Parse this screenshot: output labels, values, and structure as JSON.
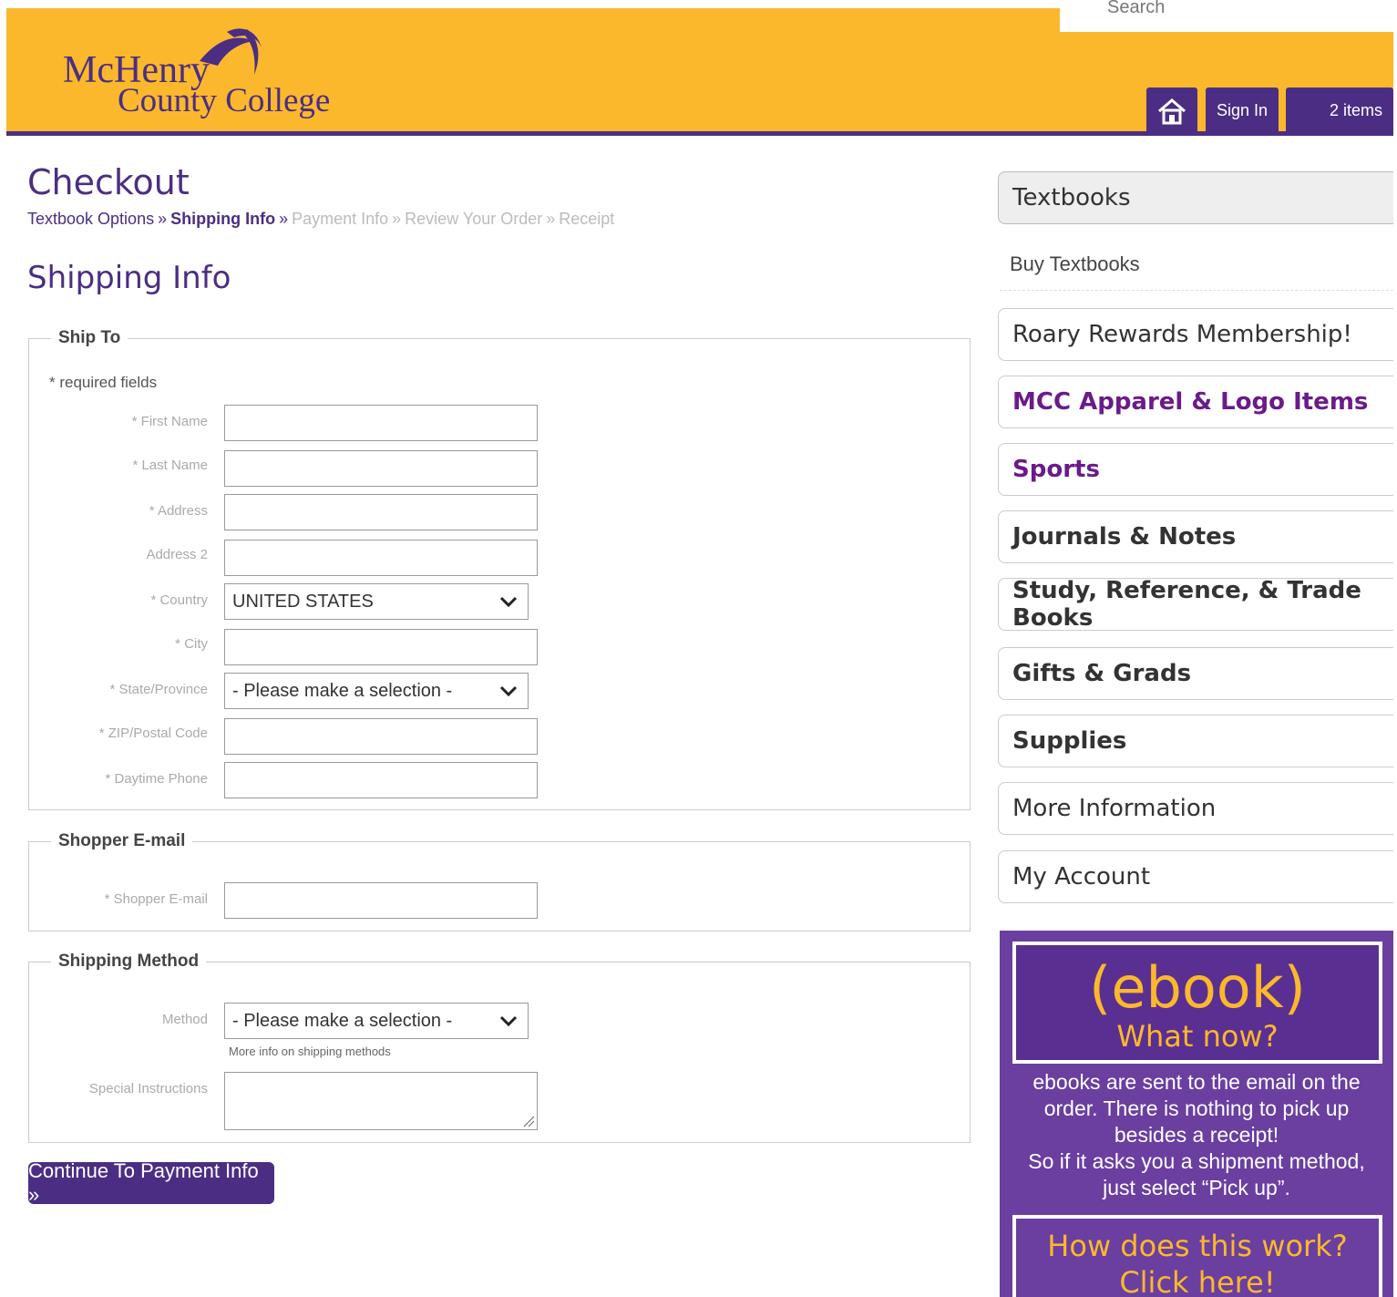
{
  "header": {
    "logo_line1": "McHenry",
    "logo_line2": "County College",
    "search_label": "Search",
    "sign_in": "Sign In",
    "cart": "2 items"
  },
  "page": {
    "title": "Checkout",
    "breadcrumbs": [
      "Textbook Options",
      "Shipping Info",
      "Payment Info",
      "Review Your Order",
      "Receipt"
    ],
    "subtitle": "Shipping Info"
  },
  "ship_to": {
    "legend": "Ship To",
    "required_note": "* required fields",
    "fields": {
      "first_name": "* First Name",
      "last_name": "* Last Name",
      "address": "* Address",
      "address2": "Address 2",
      "country": "* Country",
      "city": "* City",
      "state": "* State/Province",
      "zip": "* ZIP/Postal Code",
      "phone": "* Daytime Phone"
    },
    "country_value": "UNITED STATES",
    "state_value": "- Please make a selection -"
  },
  "email": {
    "legend": "Shopper E-mail",
    "label": "* Shopper E-mail"
  },
  "shipping_method": {
    "legend": "Shipping Method",
    "method_label": "Method",
    "method_value": "- Please make a selection -",
    "info_link": "More info on shipping methods",
    "instructions_label": "Special Instructions"
  },
  "continue_button": "Continue To Payment Info »",
  "sidebar": {
    "textbooks": "Textbooks",
    "buy_textbooks": "Buy Textbooks",
    "items": [
      "Roary Rewards Membership!",
      "MCC Apparel & Logo Items",
      "Sports",
      "Journals & Notes",
      "Study, Reference, & Trade Books",
      "Gifts & Grads",
      "Supplies",
      "More Information",
      "My Account"
    ]
  },
  "promo": {
    "ebook": "(ebook)",
    "what_now": "What now?",
    "line1": "ebooks are sent to the email on the",
    "line2": "order. There is nothing to pick up",
    "line3": "besides a receipt!",
    "line4": "So if it asks you a shipment method,",
    "line5": "just select “Pick up”.",
    "how_line1": "How does this work?",
    "how_line2": "Click here!"
  },
  "colors": {
    "brand_gold": "#fbb82c",
    "brand_purple": "#4b2e83",
    "apparel_purple": "#6a1b8a"
  }
}
